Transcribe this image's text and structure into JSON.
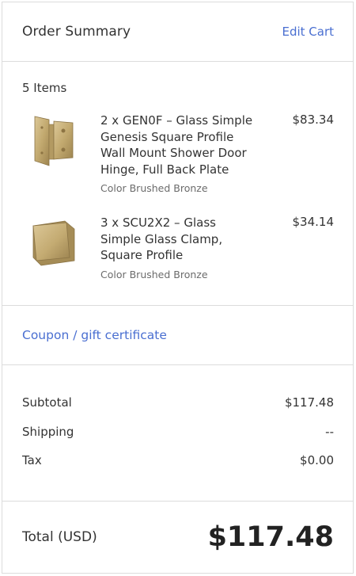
{
  "header": {
    "title": "Order Summary",
    "edit_cart": "Edit Cart"
  },
  "items_count": "5 Items",
  "items": [
    {
      "name": "2 x GEN0F – Glass Simple Genesis Square Profile Wall Mount Shower Door Hinge, Full Back Plate",
      "option": "Color Brushed Bronze",
      "price": "$83.34",
      "thumb_icon": "hinge-image"
    },
    {
      "name": "3 x SCU2X2 – Glass Simple Glass Clamp, Square Profile",
      "option": "Color Brushed Bronze",
      "price": "$34.14",
      "thumb_icon": "clamp-image"
    }
  ],
  "coupon": {
    "label": "Coupon / gift certificate"
  },
  "totals": {
    "subtotal_label": "Subtotal",
    "subtotal": "$117.48",
    "shipping_label": "Shipping",
    "shipping": "--",
    "tax_label": "Tax",
    "tax": "$0.00"
  },
  "grand_total": {
    "label": "Total (USD)",
    "value": "$117.48"
  },
  "colors": {
    "link": "#4a6fd1",
    "border": "#dcdcdc",
    "bronze": "#c9b27e"
  }
}
